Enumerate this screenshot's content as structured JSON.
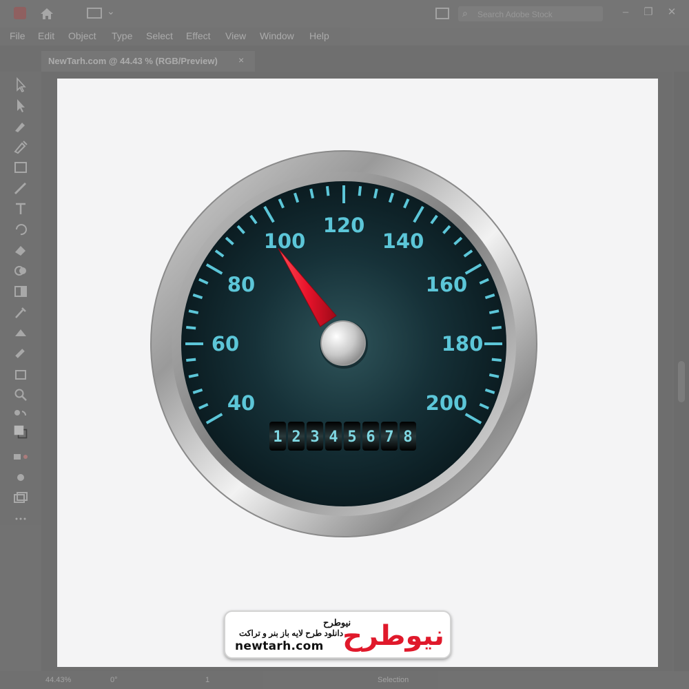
{
  "app": {
    "search": {
      "placeholder": "Search Adobe Stock"
    },
    "menu": [
      "File",
      "Edit",
      "Object",
      "Type",
      "Select",
      "Effect",
      "View",
      "Window",
      "Help"
    ],
    "document_tab": {
      "title": "NewTarh.com @ 44.43 % (RGB/Preview)",
      "close": "×"
    },
    "status": {
      "zoom": "44.43%",
      "rotation": "0°",
      "artboard": "1",
      "mode": "Selection"
    }
  },
  "gauge": {
    "labels": [
      "40",
      "60",
      "80",
      "100",
      "120",
      "140",
      "160",
      "180",
      "200"
    ],
    "min_value": 40,
    "max_value": 200,
    "needle_value": 97,
    "odometer": [
      "1",
      "2",
      "3",
      "4",
      "5",
      "6",
      "7",
      "8"
    ],
    "colors": {
      "dial": "#0d2228",
      "markings": "#5cc6d8",
      "needle": "#e8132b",
      "bezel": "#a8a8a8"
    }
  },
  "watermark": {
    "brand_fa": "نیوطرح",
    "subtitle_fa": "دانلود طرح لایه باز بنر و تراکت",
    "url": "newtarh.com",
    "logo_fa": "نیوطرح",
    "logo_color": "#e0192b"
  }
}
